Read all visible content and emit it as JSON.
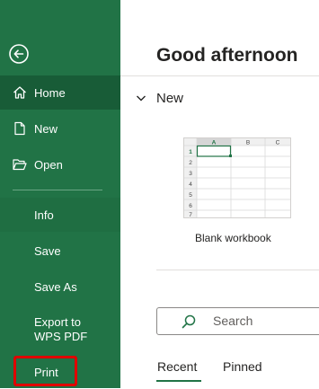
{
  "sidebar": {
    "back_icon": "back-arrow-icon",
    "items": [
      {
        "label": "Home",
        "icon": "home-icon"
      },
      {
        "label": "New",
        "icon": "new-document-icon"
      },
      {
        "label": "Open",
        "icon": "open-folder-icon"
      },
      {
        "label": "Info"
      },
      {
        "label": "Save"
      },
      {
        "label": "Save As"
      },
      {
        "label": "Export to WPS PDF"
      },
      {
        "label": "Print"
      }
    ],
    "selected": "Home",
    "colors": {
      "background": "#217346",
      "selected": "#185c37",
      "highlight": "#e00000"
    }
  },
  "main": {
    "greeting": "Good afternoon",
    "new_section": {
      "title": "New",
      "templates": [
        {
          "label": "Blank workbook",
          "columns": [
            "A",
            "B",
            "C"
          ],
          "rows": [
            "1",
            "2",
            "3",
            "4",
            "5",
            "6",
            "7"
          ]
        }
      ]
    },
    "search": {
      "placeholder": "Search"
    },
    "tabs": [
      {
        "label": "Recent",
        "active": true
      },
      {
        "label": "Pinned",
        "active": false
      }
    ]
  }
}
